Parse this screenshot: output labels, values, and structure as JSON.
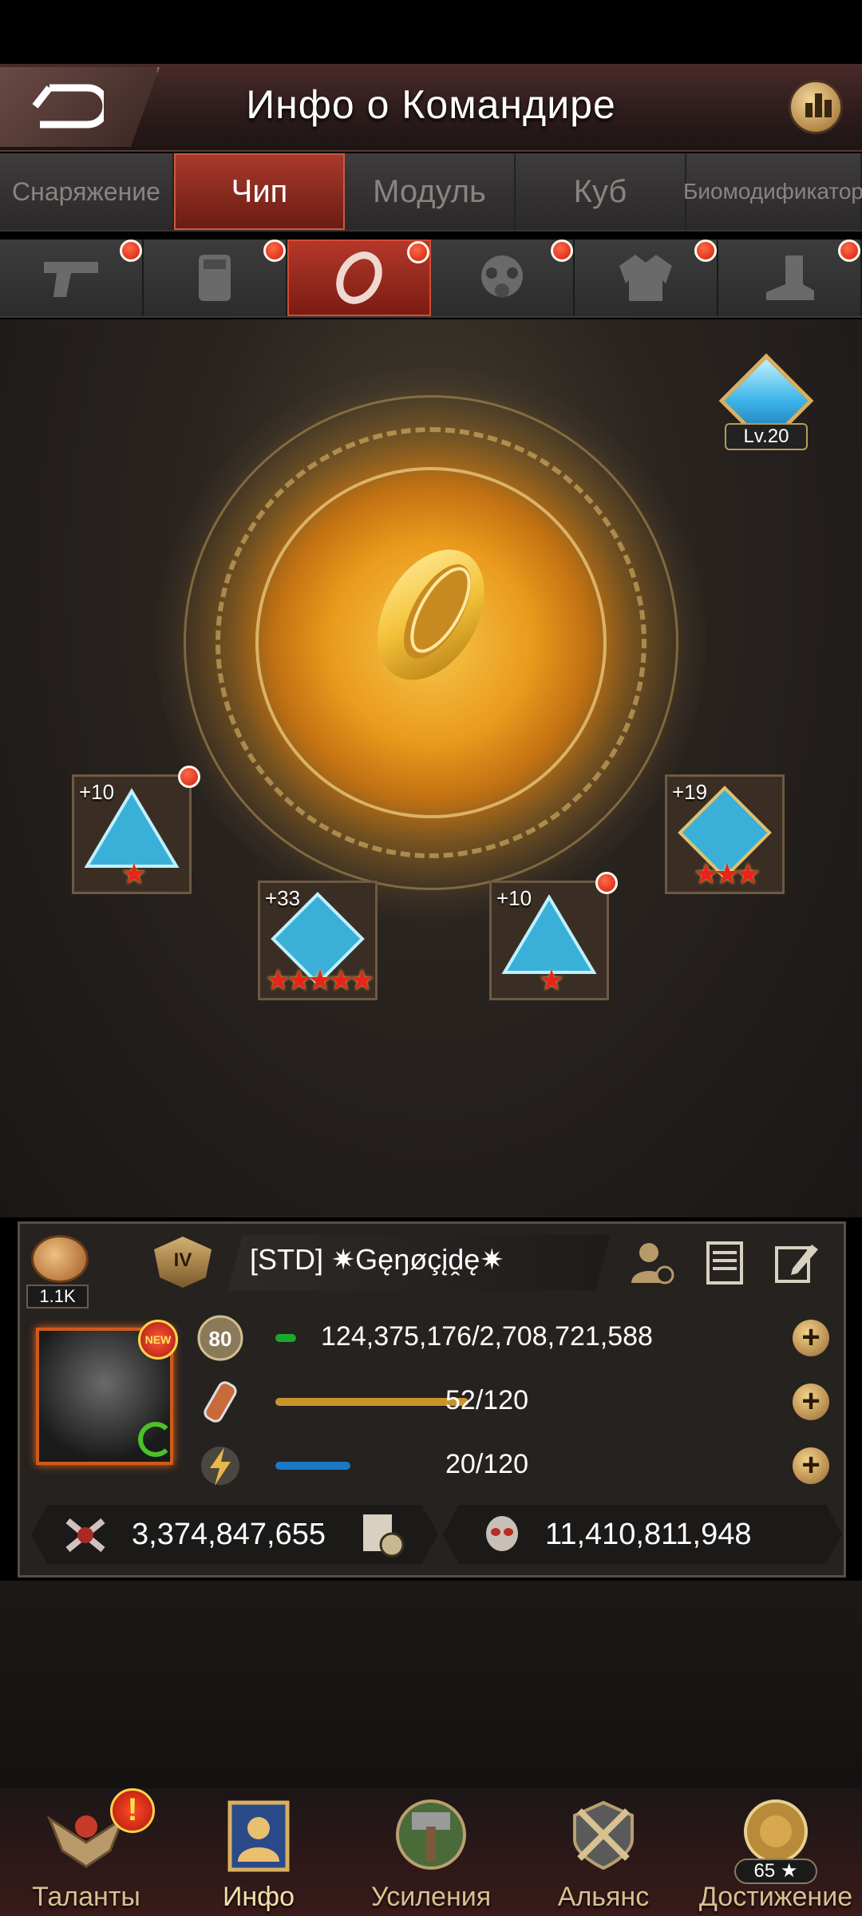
{
  "header": {
    "title": "Инфо о Командире"
  },
  "tabs": [
    {
      "label": "Снаряжение",
      "active": false
    },
    {
      "label": "Чип",
      "active": true
    },
    {
      "label": "Модуль",
      "active": false
    },
    {
      "label": "Куб",
      "active": false
    },
    {
      "label": "Биомодификатор",
      "active": false
    }
  ],
  "slots": [
    {
      "icon": "pistol-icon",
      "alert": true
    },
    {
      "icon": "armor-vest-icon",
      "alert": true
    },
    {
      "icon": "ring-icon",
      "alert": true,
      "active": true
    },
    {
      "icon": "gas-mask-icon",
      "alert": true
    },
    {
      "icon": "jacket-icon",
      "alert": true
    },
    {
      "icon": "boot-icon",
      "alert": true
    }
  ],
  "gem_badge": {
    "level": "Lv.20"
  },
  "chips": [
    {
      "plus": "+10",
      "stars": "★",
      "alert": true
    },
    {
      "plus": "+33",
      "stars": "★★★★★",
      "alert": false
    },
    {
      "plus": "+10",
      "stars": "★",
      "alert": true
    },
    {
      "plus": "+19",
      "stars": "★★★",
      "alert": false
    }
  ],
  "player": {
    "likes": "1.1K",
    "rank": "IV",
    "name": "[STD]  ✷Gęŋøçįḓę✷",
    "new_badge": "NEW",
    "level": "80",
    "exp": "124,375,176/2,708,721,588",
    "exp_fraction": 0.046,
    "stamina": "52/120",
    "stamina_fraction": 0.433,
    "energy": "20/120",
    "energy_fraction": 0.167,
    "power": "3,374,847,655",
    "kills": "11,410,811,948"
  },
  "colors": {
    "accent_red": "#a83a2a",
    "exp_bar": "#1aa82a",
    "stamina_bar": "#c8942a",
    "energy_bar": "#1a78c8"
  },
  "nav": [
    {
      "label": "Таланты",
      "icon": "talents-icon",
      "alert": "!"
    },
    {
      "label": "Инфо",
      "icon": "info-icon",
      "active": true
    },
    {
      "label": "Усиления",
      "icon": "hammer-icon"
    },
    {
      "label": "Альянс",
      "icon": "alliance-swords-icon"
    },
    {
      "label": "Достижение",
      "icon": "achievement-lion-icon",
      "count": "65 ★"
    }
  ]
}
